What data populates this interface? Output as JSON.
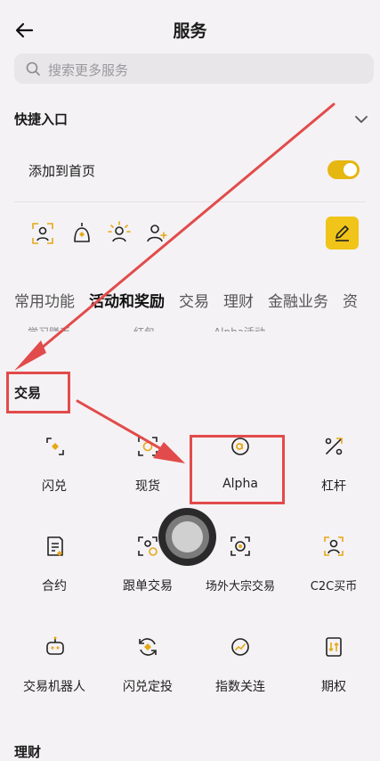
{
  "header": {
    "title": "服务"
  },
  "search": {
    "placeholder": "搜索更多服务"
  },
  "quick": {
    "title": "快捷入口",
    "add_home_label": "添加到首页",
    "add_home_on": true
  },
  "tabs": [
    "常用功能",
    "活动和奖励",
    "交易",
    "理财",
    "金融业务",
    "资"
  ],
  "cut_row": [
    "学习赚币",
    "红包",
    "Alpha活动"
  ],
  "trade": {
    "title": "交易",
    "items": [
      "闪兑",
      "现货",
      "Alpha",
      "杠杆",
      "合约",
      "跟单交易",
      "场外大宗交易",
      "C2C买币",
      "交易机器人",
      "闪兑定投",
      "指数关连",
      "期权"
    ]
  },
  "finance": {
    "title": "理财"
  },
  "colors": {
    "accent": "#f0c419",
    "annotation": "#e24b4b"
  }
}
